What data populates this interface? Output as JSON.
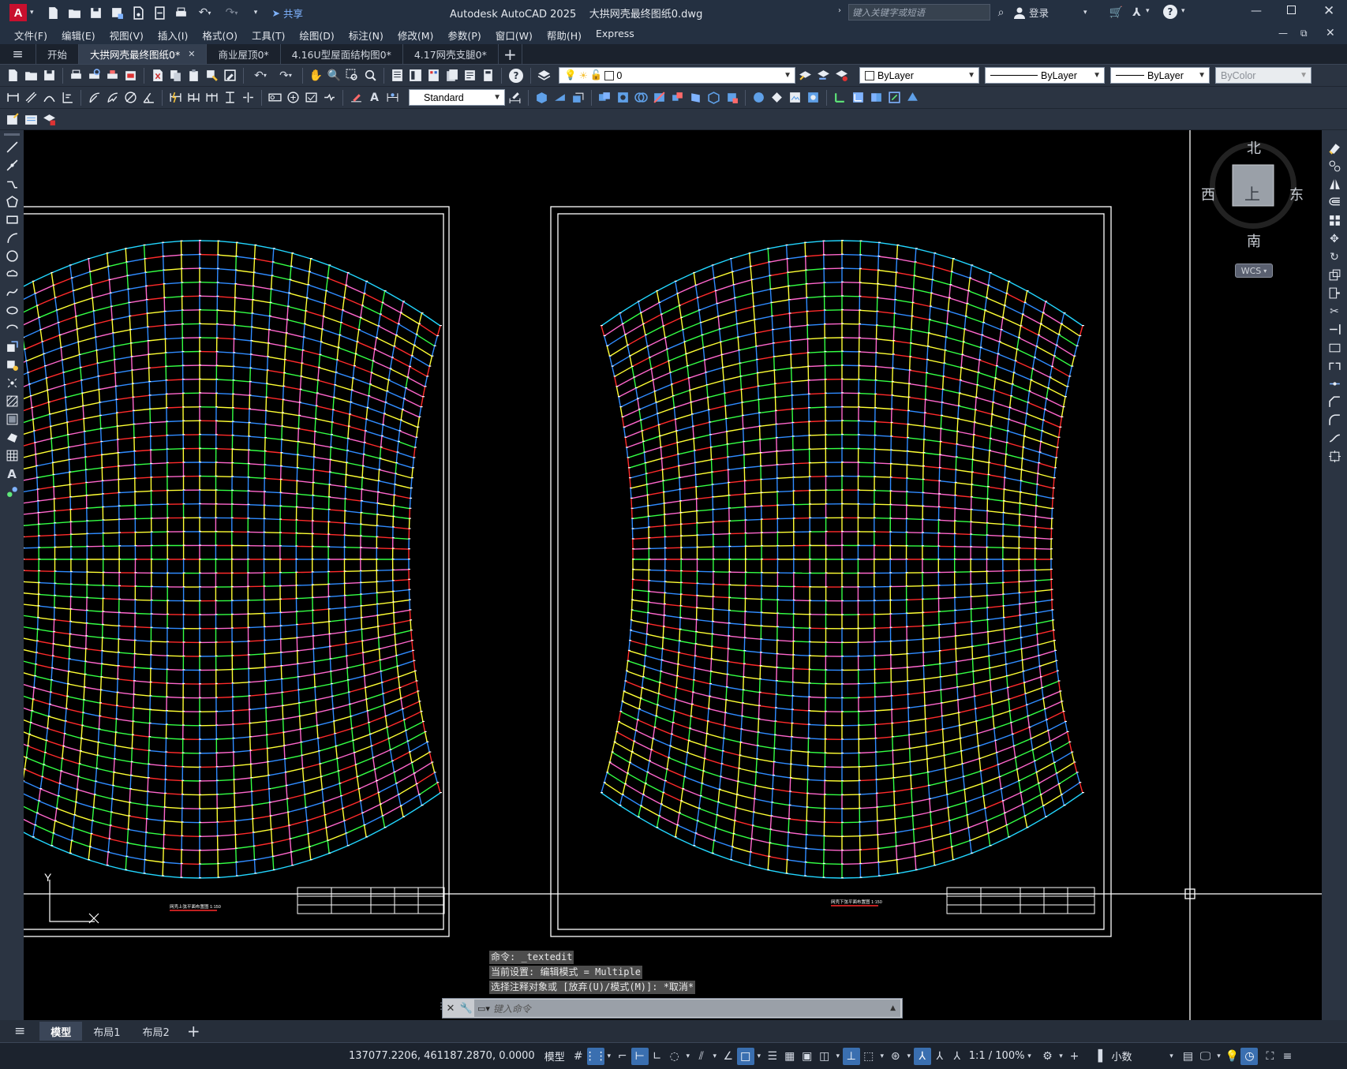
{
  "window": {
    "app_badge": "A",
    "title": "Autodesk AutoCAD 2025    大拱网壳最终图纸0.dwg",
    "share_label": "共享",
    "search_placeholder": "键入关键字或短语",
    "login_label": "登录"
  },
  "menu": [
    "文件(F)",
    "编辑(E)",
    "视图(V)",
    "插入(I)",
    "格式(O)",
    "工具(T)",
    "绘图(D)",
    "标注(N)",
    "修改(M)",
    "参数(P)",
    "窗口(W)",
    "帮助(H)",
    "Express"
  ],
  "tabs": [
    {
      "label": "开始",
      "active": false,
      "closable": false
    },
    {
      "label": "大拱网壳最终图纸0*",
      "active": true,
      "closable": true
    },
    {
      "label": "商业屋顶0*",
      "active": false,
      "closable": false
    },
    {
      "label": "4.16U型屋面结构图0*",
      "active": false,
      "closable": false
    },
    {
      "label": "4.17网壳支腿0*",
      "active": false,
      "closable": false
    }
  ],
  "properties": {
    "layer_value": "0",
    "color_value": "ByLayer",
    "linetype_value": "ByLayer",
    "lineweight_value": "ByLayer",
    "plotstyle_value": "ByColor",
    "dimstyle_value": "Standard"
  },
  "navcube": {
    "north": "北",
    "south": "南",
    "east": "东",
    "west": "西",
    "face": "上",
    "ucs": "WCS"
  },
  "drawing": {
    "left_caption": "网壳上弦平面布置图 1:150",
    "right_caption": "网壳下弦平面布置图 1:150",
    "ucs_y": "Y"
  },
  "command": {
    "history": [
      "命令: _textedit",
      "当前设置: 编辑模式 = Multiple",
      "选择注释对象或 [放弃(U)/模式(M)]: *取消*"
    ],
    "placeholder": "键入命令"
  },
  "model_tabs": [
    "模型",
    "布局1",
    "布局2"
  ],
  "status": {
    "coordinates": "137077.2206, 461187.2870, 0.0000",
    "model_label": "模型",
    "scale": "1:1 / 100%",
    "units": "小数"
  },
  "colors": {
    "canvas": "#000000",
    "grid_palette": [
      "#ff2a2a",
      "#2f8bff",
      "#ffff33",
      "#33ff44",
      "#ff66cc",
      "#22d6ff",
      "#ffffff"
    ],
    "accent": "#3a6fb0"
  }
}
